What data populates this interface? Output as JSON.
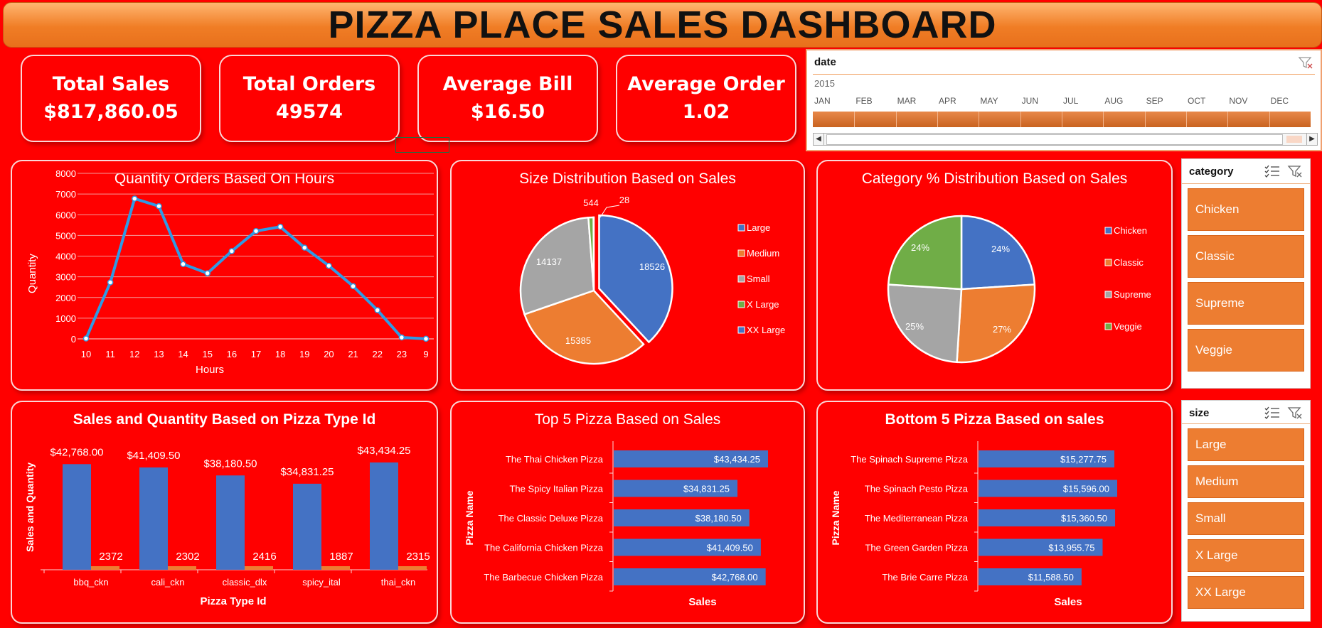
{
  "dashboard": {
    "title": "PIZZA PLACE SALES DASHBOARD"
  },
  "kpis": [
    {
      "label": "Total Sales",
      "value": "$817,860.05"
    },
    {
      "label": "Total Orders",
      "value": "49574"
    },
    {
      "label": "Average Bill",
      "value": "$16.50"
    },
    {
      "label": "Average Order",
      "value": "1.02"
    }
  ],
  "date_slicer": {
    "title": "date",
    "year": "2015",
    "months": [
      "JAN",
      "FEB",
      "MAR",
      "APR",
      "MAY",
      "JUN",
      "JUL",
      "AUG",
      "SEP",
      "OCT",
      "NOV",
      "DEC"
    ]
  },
  "category_slicer": {
    "title": "category",
    "items": [
      "Chicken",
      "Classic",
      "Supreme",
      "Veggie"
    ]
  },
  "size_slicer": {
    "title": "size",
    "items": [
      "Large",
      "Medium",
      "Small",
      "X Large",
      "XX Large"
    ]
  },
  "colors": {
    "blue": "#4472c4",
    "orange": "#ed7d31",
    "gray": "#a5a5a5",
    "green": "#70ad47",
    "line": "#2e9be5",
    "bg": "#ff0000"
  },
  "chart_data": [
    {
      "type": "line",
      "title": "Quantity Orders Based On Hours",
      "xlabel": "Hours",
      "ylabel": "Quantity",
      "categories": [
        "10",
        "11",
        "12",
        "13",
        "14",
        "15",
        "16",
        "17",
        "18",
        "19",
        "20",
        "21",
        "22",
        "23",
        "9"
      ],
      "values": [
        17,
        2728,
        6776,
        6413,
        3613,
        3170,
        4239,
        5211,
        5417,
        4406,
        3534,
        2545,
        1386,
        68,
        4
      ],
      "ylim": [
        0,
        8000
      ],
      "yticks": [
        "0",
        "1000",
        "2000",
        "3000",
        "4000",
        "5000",
        "6000",
        "7000",
        "8000"
      ],
      "grid": true
    },
    {
      "type": "pie",
      "title": "Size Distribution Based on Sales",
      "labels": [
        "Large",
        "Medium",
        "Small",
        "X Large",
        "XX Large"
      ],
      "values": [
        18526,
        15385,
        14137,
        544,
        28
      ],
      "value_labels": [
        "18526",
        "15385",
        "14137",
        "544",
        "28"
      ],
      "legend": "right"
    },
    {
      "type": "pie",
      "title": "Category % Distribution Based on Sales",
      "labels": [
        "Chicken",
        "Classic",
        "Supreme",
        "Veggie"
      ],
      "values": [
        24,
        27,
        25,
        24
      ],
      "value_labels": [
        "24%",
        "27%",
        "25%",
        "24%"
      ],
      "legend": "right"
    },
    {
      "type": "bar",
      "title": "Sales and Quantity Based on Pizza Type Id",
      "xlabel": "Pizza Type Id",
      "ylabel": "Sales and Quantity",
      "categories": [
        "bbq_ckn",
        "cali_ckn",
        "classic_dlx",
        "spicy_ital",
        "thai_ckn"
      ],
      "series": [
        {
          "values": [
            42768.0,
            41409.5,
            38180.5,
            34831.25,
            43434.25
          ],
          "labels": [
            "$42,768.00",
            "$41,409.50",
            "$38,180.50",
            "$34,831.25",
            "$43,434.25"
          ]
        },
        {
          "values": [
            2372,
            2302,
            2416,
            1887,
            2315
          ],
          "labels": [
            "2372",
            "2302",
            "2416",
            "1887",
            "2315"
          ]
        }
      ]
    },
    {
      "type": "bar",
      "orientation": "horizontal",
      "title": "Top 5 Pizza Based on Sales",
      "xlabel": "Sales",
      "ylabel": "Pizza Name",
      "categories": [
        "The Thai Chicken Pizza",
        "The Spicy Italian Pizza",
        "The Classic Deluxe Pizza",
        "The California Chicken Pizza",
        "The Barbecue Chicken Pizza"
      ],
      "values": [
        43434.25,
        34831.25,
        38180.5,
        41409.5,
        42768.0
      ],
      "labels": [
        "$43,434.25",
        "$34,831.25",
        "$38,180.50",
        "$41,409.50",
        "$42,768.00"
      ]
    },
    {
      "type": "bar",
      "orientation": "horizontal",
      "title": "Bottom 5 Pizza Based on sales",
      "xlabel": "Sales",
      "ylabel": "Pizza Name",
      "categories": [
        "The Spinach Supreme Pizza",
        "The Spinach Pesto Pizza",
        "The Mediterranean Pizza",
        "The Green Garden Pizza",
        "The Brie Carre Pizza"
      ],
      "values": [
        15277.75,
        15596.0,
        15360.5,
        13955.75,
        11588.5
      ],
      "labels": [
        "$15,277.75",
        "$15,596.00",
        "$15,360.50",
        "$13,955.75",
        "$11,588.50"
      ]
    }
  ]
}
